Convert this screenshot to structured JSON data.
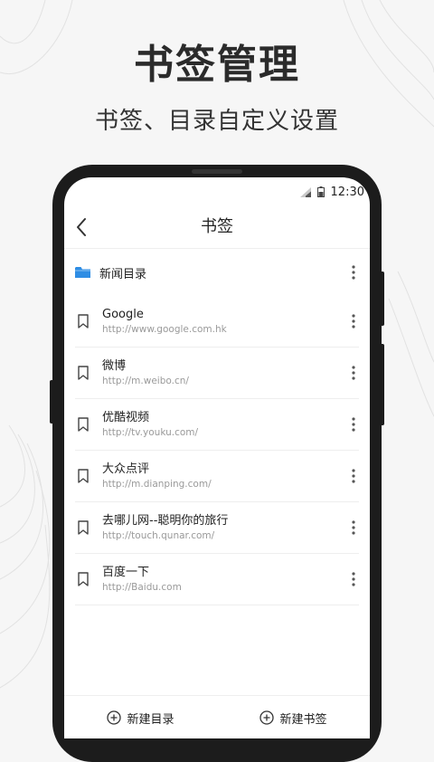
{
  "promo": {
    "title": "书签管理",
    "subtitle": "书签、目录自定义设置"
  },
  "status_bar": {
    "time": "12:30",
    "signal_icon": "signal-icon",
    "battery_icon": "battery-icon"
  },
  "navbar": {
    "back_icon": "back-arrow-icon",
    "title": "书签"
  },
  "folder": {
    "icon": "folder-icon",
    "name": "新闻目录",
    "more_icon": "more-vertical-icon"
  },
  "bookmarks": [
    {
      "title": "Google",
      "url": "http://www.google.com.hk"
    },
    {
      "title": "微博",
      "url": "http://m.weibo.cn/"
    },
    {
      "title": "优酷视频",
      "url": "http://tv.youku.com/"
    },
    {
      "title": "大众点评",
      "url": "http://m.dianping.com/"
    },
    {
      "title": "去哪儿网--聪明你的旅行",
      "url": "http://touch.qunar.com/"
    },
    {
      "title": "百度一下",
      "url": "http://Baidu.com"
    }
  ],
  "bottom_bar": {
    "new_folder_label": "新建目录",
    "new_bookmark_label": "新建书签"
  },
  "colors": {
    "accent_folder": "#2f8de4",
    "text_primary": "#222222",
    "text_secondary": "#9a9a9a",
    "phone_frame": "#1c1c1c"
  }
}
